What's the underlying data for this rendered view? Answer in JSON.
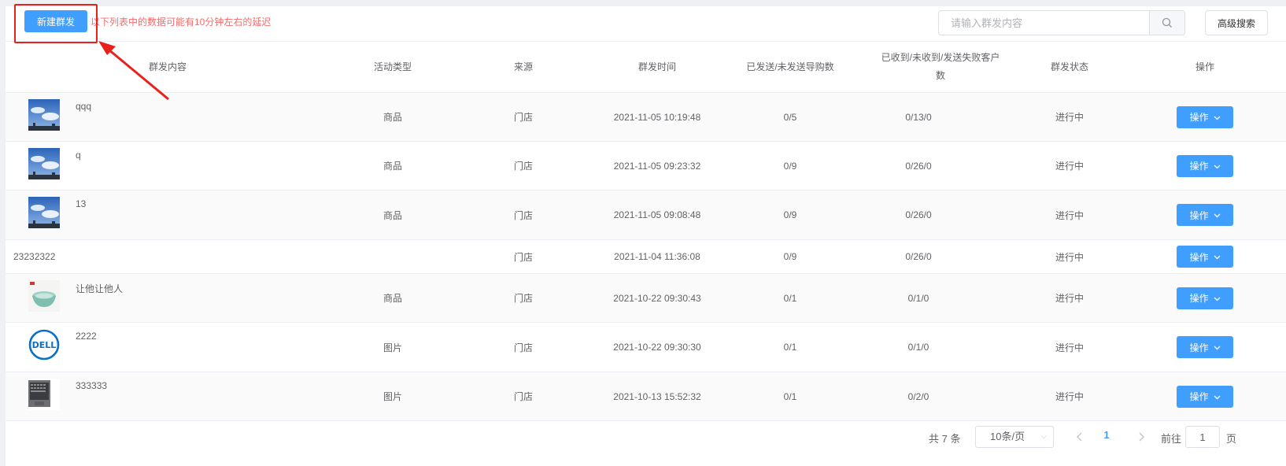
{
  "toolbar": {
    "new_button": "新建群发",
    "hint": "以下列表中的数据可能有10分钟左右的延迟",
    "search_placeholder": "请输入群发内容",
    "advanced_search": "高级搜索"
  },
  "table": {
    "headers": [
      "群发内容",
      "活动类型",
      "来源",
      "群发时间",
      "已发送/未发送导购数",
      "已收到/未收到/发送失败客户数",
      "群发状态",
      "操作"
    ],
    "rows": [
      {
        "content": "qqq",
        "thumb": "sky-image",
        "type": "商品",
        "source": "门店",
        "time": "2021-11-05 10:19:48",
        "sent": "0/5",
        "received": "0/13/0",
        "status": "进行中",
        "action": "操作"
      },
      {
        "content": "q",
        "thumb": "sky-image",
        "type": "商品",
        "source": "门店",
        "time": "2021-11-05 09:23:32",
        "sent": "0/9",
        "received": "0/26/0",
        "status": "进行中",
        "action": "操作"
      },
      {
        "content": "13",
        "thumb": "sky-image",
        "type": "商品",
        "source": "门店",
        "time": "2021-11-05 09:08:48",
        "sent": "0/9",
        "received": "0/26/0",
        "status": "进行中",
        "action": "操作"
      },
      {
        "content": "23232322",
        "thumb": "",
        "type": "",
        "source": "门店",
        "time": "2021-11-04 11:36:08",
        "sent": "0/9",
        "received": "0/26/0",
        "status": "进行中",
        "action": "操作"
      },
      {
        "content": "让他让他人",
        "thumb": "bowl-image",
        "type": "商品",
        "source": "门店",
        "time": "2021-10-22 09:30:43",
        "sent": "0/1",
        "received": "0/1/0",
        "status": "进行中",
        "action": "操作"
      },
      {
        "content": "2222",
        "thumb": "dell-logo",
        "type": "图片",
        "source": "门店",
        "time": "2021-10-22 09:30:30",
        "sent": "0/1",
        "received": "0/1/0",
        "status": "进行中",
        "action": "操作"
      },
      {
        "content": "333333",
        "thumb": "laptop-image",
        "type": "图片",
        "source": "门店",
        "time": "2021-10-13 15:52:32",
        "sent": "0/1",
        "received": "0/2/0",
        "status": "进行中",
        "action": "操作"
      }
    ]
  },
  "pagination": {
    "total": "共 7 条",
    "page_size": "10条/页",
    "current_page": "1",
    "goto_label": "前往",
    "goto_value": "1",
    "goto_unit": "页"
  },
  "colors": {
    "primary": "#409eff",
    "hint_red": "#f56c6c",
    "annotation_red": "#e8221b"
  }
}
